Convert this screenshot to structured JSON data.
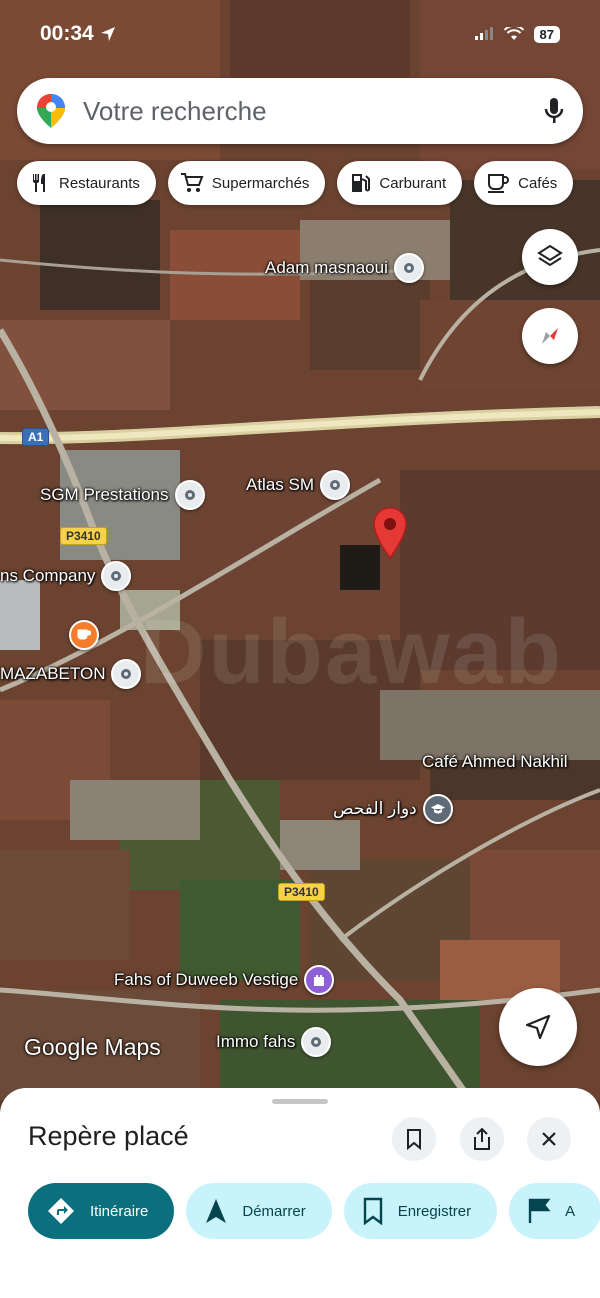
{
  "status_bar": {
    "time": "00:34",
    "battery": "87"
  },
  "search": {
    "placeholder": "Votre recherche"
  },
  "chips": [
    {
      "label": "Restaurants",
      "icon": "fork-knife-icon"
    },
    {
      "label": "Supermarchés",
      "icon": "cart-icon"
    },
    {
      "label": "Carburant",
      "icon": "fuel-icon"
    },
    {
      "label": "Cafés",
      "icon": "coffee-cup-icon"
    }
  ],
  "map": {
    "roads": {
      "a1": "A1",
      "p3410_top": "P3410",
      "p3410_bottom": "P3410"
    },
    "places": {
      "adam": "Adam masnaoui",
      "sgm": "SGM Prestations",
      "atlas": "Atlas SM",
      "company": "ns Company",
      "mazabeton": "MAZABETON",
      "cafe_ahmed": "Café Ahmed Nakhil",
      "douar": "دوار الفحص",
      "fahs": "Fahs of Duweeb Vestige",
      "immo": "Immo fahs"
    },
    "watermark": "Dubawab",
    "logo": "Google Maps"
  },
  "sheet": {
    "title": "Repère placé",
    "actions": [
      "Itinéraire",
      "Démarrer",
      "Enregistrer",
      "A"
    ]
  },
  "colors": {
    "primary": "#0b6f7d",
    "secondary_bg": "#c9f3fb",
    "pin_red": "#e53935"
  }
}
